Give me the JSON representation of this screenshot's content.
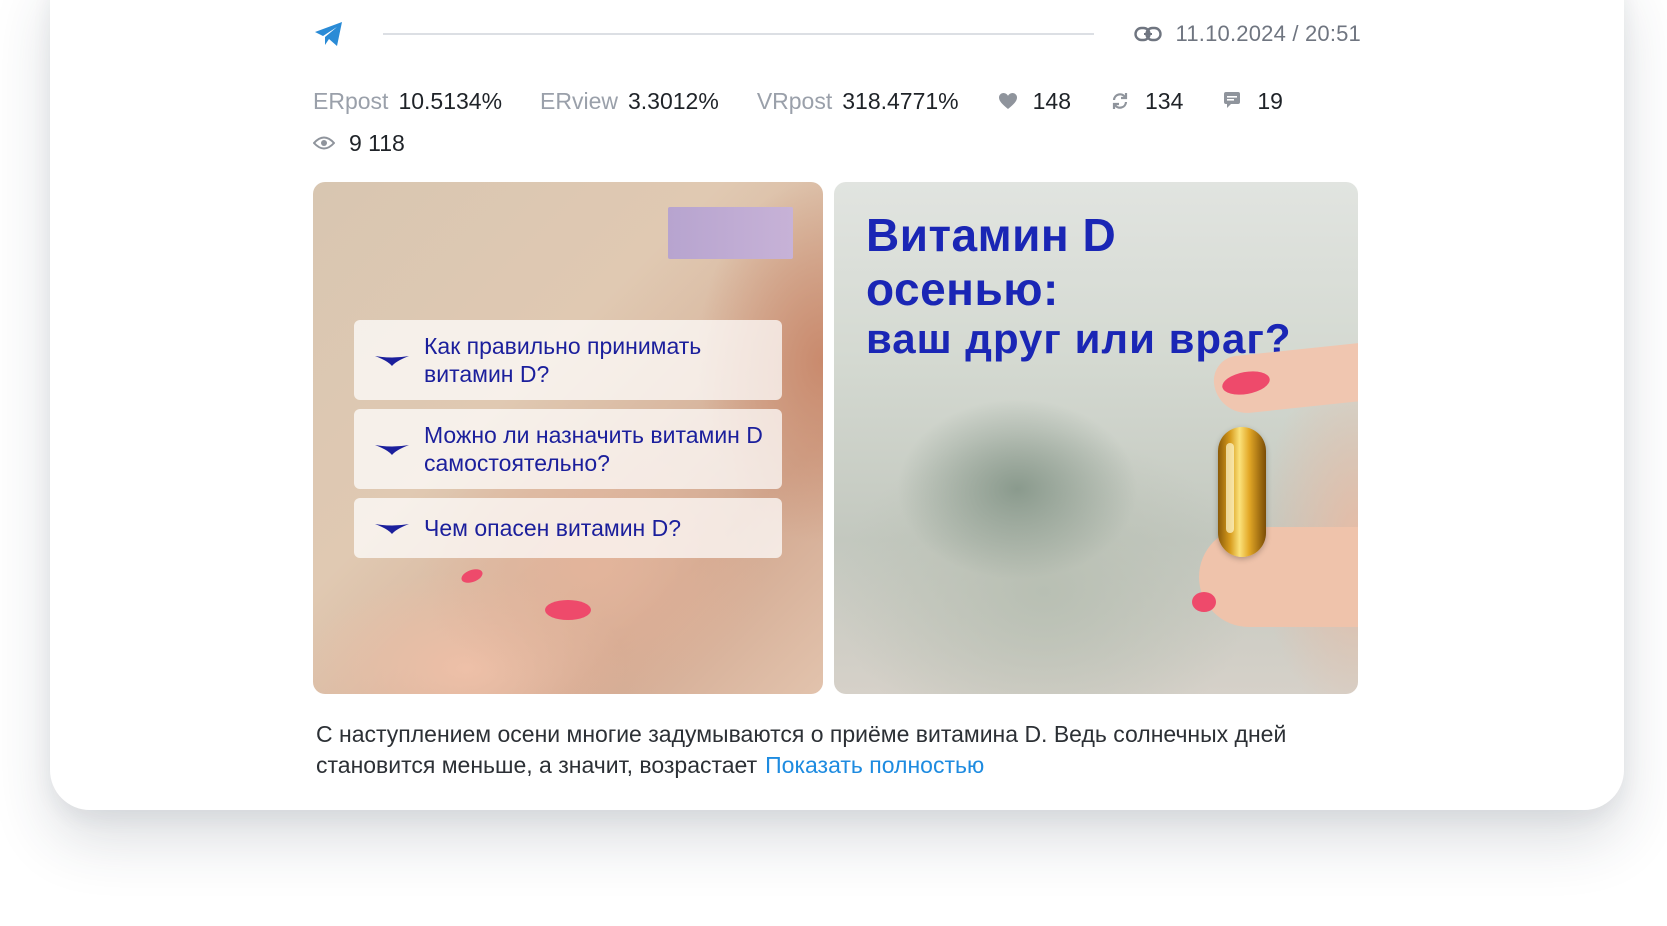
{
  "post": {
    "date": "11.10.2024 / 20:51",
    "stats": {
      "erpost_label": "ERpost",
      "erpost_value": "10.5134%",
      "erview_label": "ERview",
      "erview_value": "3.3012%",
      "vrpost_label": "VRpost",
      "vrpost_value": "318.4771%",
      "likes": "148",
      "reposts": "134",
      "comments": "19",
      "views": "9 118"
    },
    "image_left": {
      "questions": [
        "Как правильно принимать витамин D?",
        "Можно ли назначить витамин D самостоятельно?",
        "Чем опасен витамин D?"
      ]
    },
    "image_right": {
      "title_line1": "Витамин D",
      "title_line2": "осенью:",
      "subtitle": "ваш друг или враг?"
    },
    "text": "С наступлением осени многие задумываются о приёме витамина D. Ведь солнечных дней становится меньше, а значит, возрастает",
    "show_more": "Показать полностью"
  },
  "colors": {
    "accent": "#1e8be0",
    "brand_blue": "#1a26b5",
    "label_gray": "#9aa0aa"
  },
  "icons": [
    "telegram-icon",
    "link-icon",
    "heart-icon",
    "repost-icon",
    "comment-icon",
    "eye-icon",
    "chevron-icon"
  ]
}
